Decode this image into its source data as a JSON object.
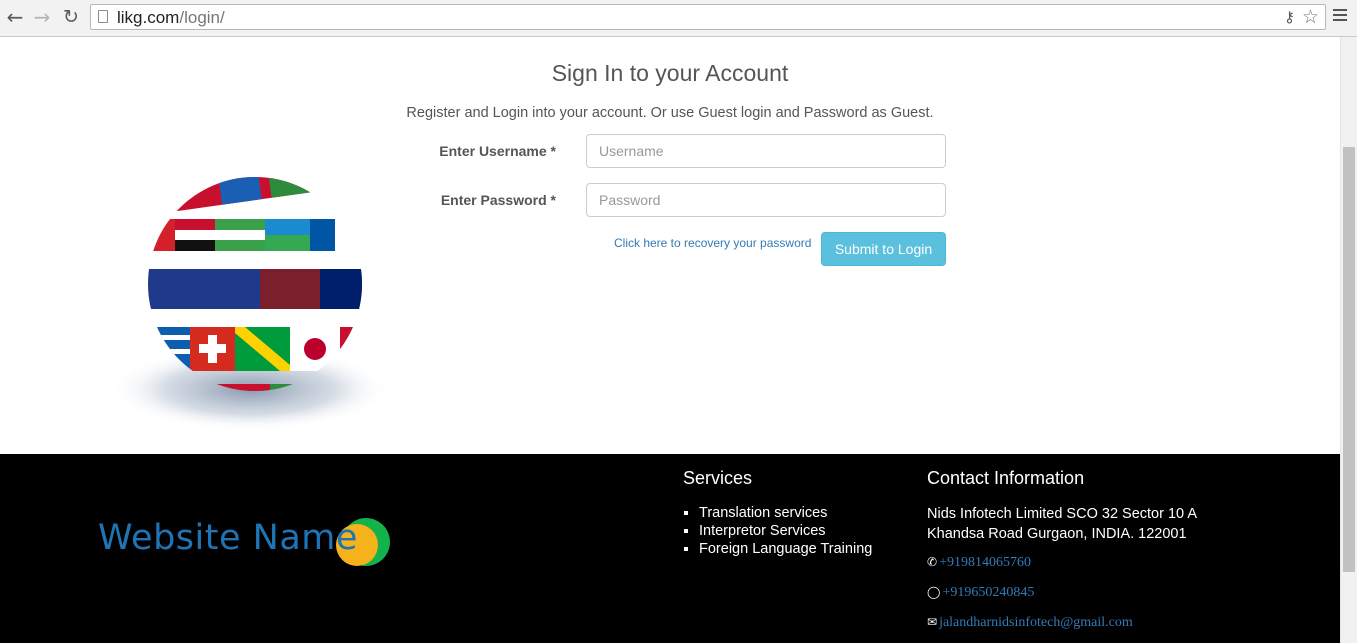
{
  "browser": {
    "url_host": "likg.com",
    "url_path": "/login/"
  },
  "login": {
    "title": "Sign In to your Account",
    "subtitle": "Register and Login into your account. Or use Guest login and Password as Guest.",
    "username_label": "Enter Username",
    "username_placeholder": "Username",
    "password_label": "Enter Password",
    "password_placeholder": "Password",
    "required_mark": "*",
    "recover_link": "Click here to recovery your password",
    "submit_label": "Submit to Login"
  },
  "footer": {
    "logo_text": "Website Name",
    "services_heading": "Services",
    "services": [
      "Translation services",
      "Interpretor Services",
      "Foreign Language Training"
    ],
    "contact_heading": "Contact Information",
    "address_line1": "Nids Infotech Limited SCO 32 Sector 10 A",
    "address_line2": "Khandsa Road Gurgaon, INDIA. 122001",
    "phone": "+919814065760",
    "whatsapp": "+919650240845",
    "email": "jalandharnidsinfotech@gmail.com"
  },
  "icons": {
    "back": "back-arrow-icon",
    "forward": "forward-arrow-icon",
    "reload": "reload-icon",
    "page": "page-icon",
    "key": "key-icon",
    "star": "bookmark-star-icon",
    "menu": "hamburger-menu-icon",
    "phone": "phone-icon",
    "whatsapp": "whatsapp-icon",
    "email": "envelope-icon"
  },
  "colors": {
    "accent_button": "#5bc0de",
    "link": "#337ab7",
    "logo_blue": "#1e74b5",
    "footer_bg": "#000000"
  }
}
